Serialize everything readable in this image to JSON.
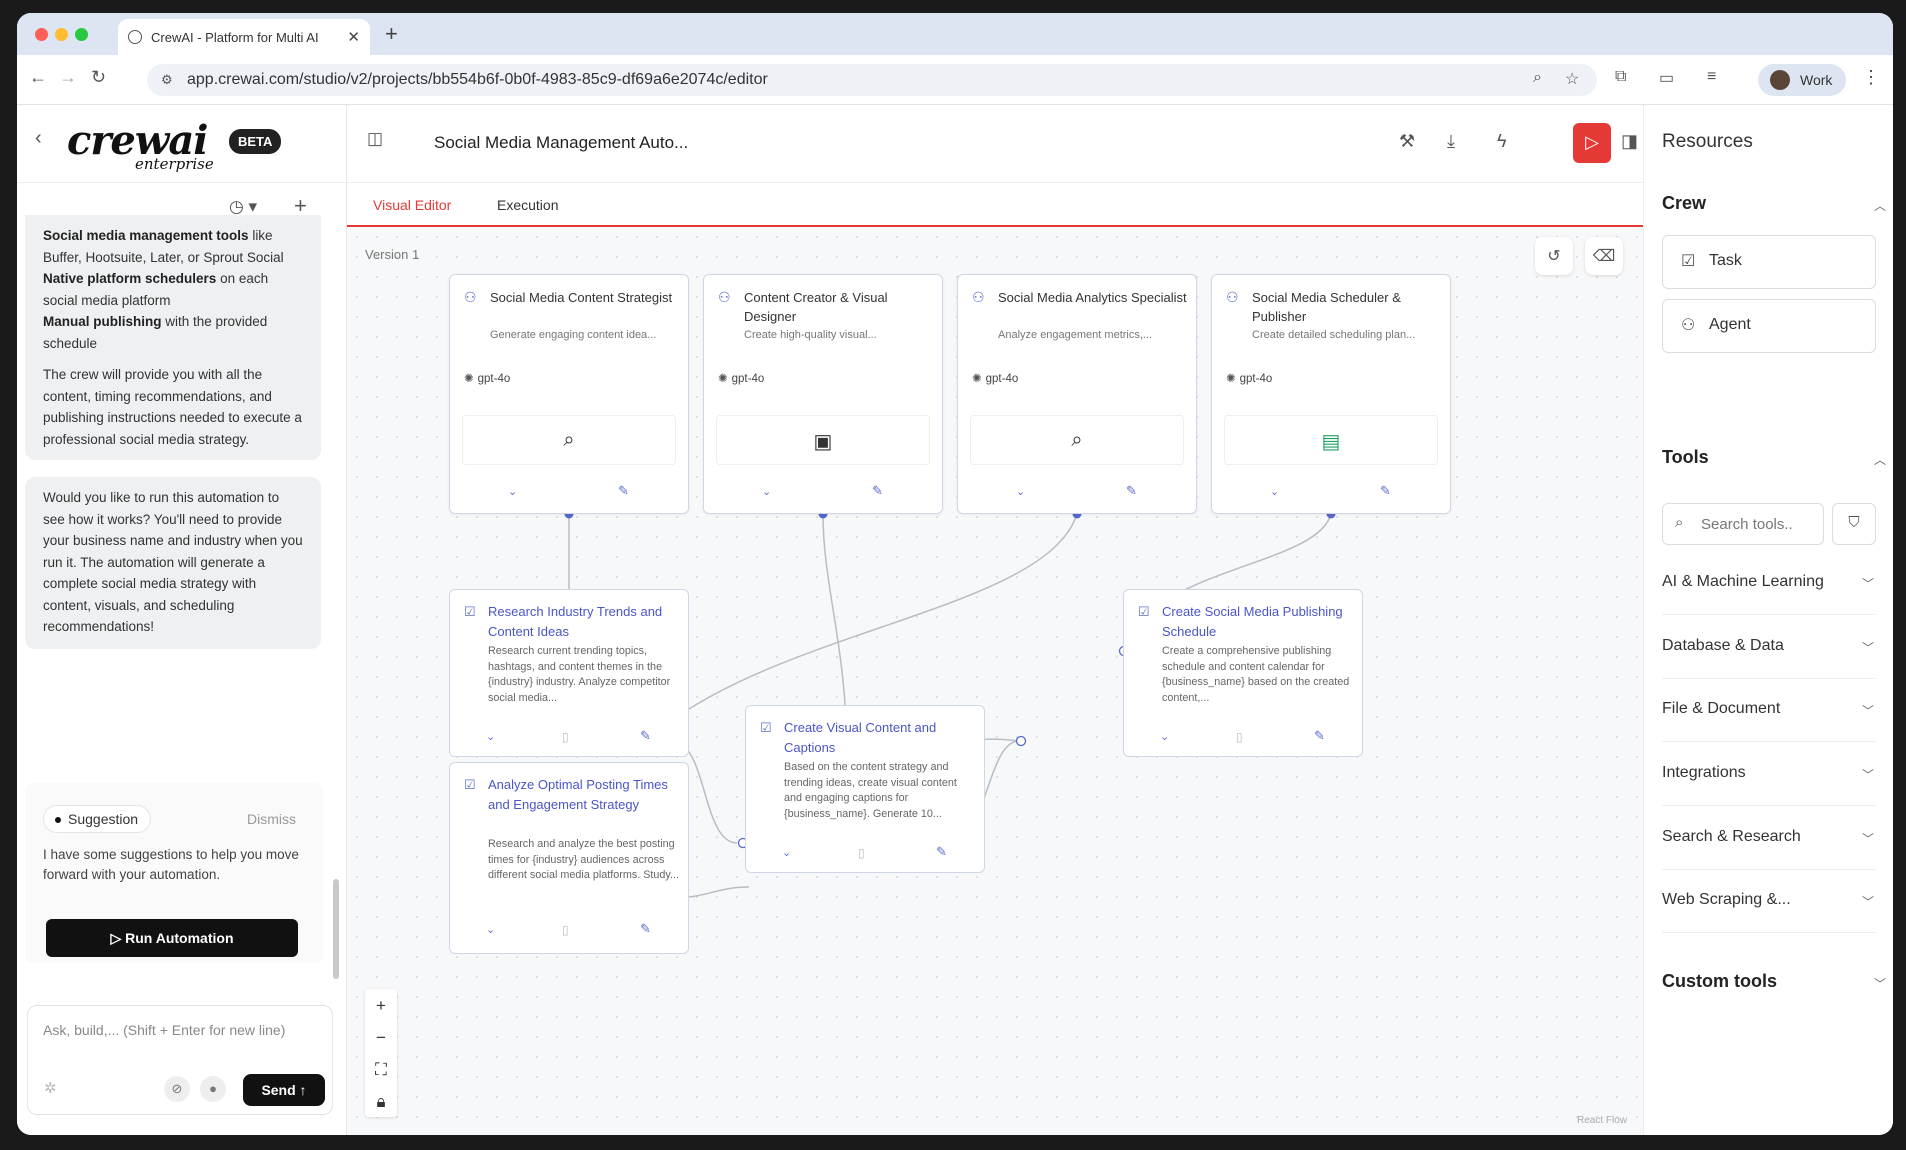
{
  "browser": {
    "tab_title": "CrewAI - Platform for Multi AI",
    "url": "app.crewai.com/studio/v2/projects/bb554b6f-0b0f-4983-85c9-df69a6e2074c/editor",
    "profile": "Work"
  },
  "sidebar": {
    "logo_text": "crewai",
    "logo_sub": "enterprise",
    "badge": "BETA",
    "message1": {
      "l1b": "Social media management tools",
      "l1": " like Buffer, Hootsuite, Later, or Sprout Social",
      "l2b": "Native platform schedulers",
      "l2": " on each social media platform",
      "l3b": "Manual publishing",
      "l3": " with the provided schedule",
      "p2": "The crew will provide you with all the content, timing recommendations, and publishing instructions needed to execute a professional social media strategy."
    },
    "message2": "Would you like to run this automation to see how it works? You'll need to provide your business name and industry when you run it. The automation will generate a complete social media strategy with content, visuals, and scheduling recommendations!",
    "suggestion": {
      "chip": "Suggestion",
      "dismiss": "Dismiss",
      "text": "I have some suggestions to help you move forward with your automation.",
      "button": "Run Automation"
    },
    "input_placeholder": "Ask, build,... (Shift + Enter for new line)",
    "send": "Send"
  },
  "header": {
    "title": "Social Media Management Auto...",
    "tabs": [
      "Visual Editor",
      "Execution"
    ]
  },
  "canvas": {
    "version": "Version 1",
    "footer": "React Flow",
    "agents": [
      {
        "name": "Social Media Content Strategist",
        "desc": "Generate engaging content idea...",
        "model": "gpt-4o",
        "tool_icon": "search-icon"
      },
      {
        "name": "Content Creator & Visual Designer",
        "desc": "Create high-quality visual...",
        "model": "gpt-4o",
        "tool_icon": "image-icon"
      },
      {
        "name": "Social Media Analytics Specialist",
        "desc": "Analyze engagement metrics,...",
        "model": "gpt-4o",
        "tool_icon": "search-icon"
      },
      {
        "name": "Social Media Scheduler & Publisher",
        "desc": "Create detailed scheduling plan...",
        "model": "gpt-4o",
        "tool_icon": "sheets-icon"
      }
    ],
    "tasks": [
      {
        "name": "Research Industry Trends and Content Ideas",
        "desc": "Research current trending topics, hashtags, and content themes in the {industry} industry. Analyze competitor social media..."
      },
      {
        "name": "Analyze Optimal Posting Times and Engagement Strategy",
        "desc": "Research and analyze the best posting times for {industry} audiences across different social media platforms. Study..."
      },
      {
        "name": "Create Visual Content and Captions",
        "desc": "Based on the content strategy and trending ideas, create visual content and engaging captions for {business_name}. Generate 10..."
      },
      {
        "name": "Create Social Media Publishing Schedule",
        "desc": "Create a comprehensive publishing schedule and content calendar for {business_name} based on the created content,..."
      }
    ]
  },
  "resources": {
    "title": "Resources",
    "crew_label": "Crew",
    "task_btn": "Task",
    "agent_btn": "Agent",
    "tools_label": "Tools",
    "search_placeholder": "Search tools..",
    "categories": [
      "AI & Machine Learning",
      "Database & Data",
      "File & Document",
      "Integrations",
      "Search & Research",
      "Web Scraping &..."
    ],
    "custom_tools": "Custom tools"
  },
  "colors": {
    "accent": "#e53935",
    "node_blue": "#4a55c7"
  }
}
